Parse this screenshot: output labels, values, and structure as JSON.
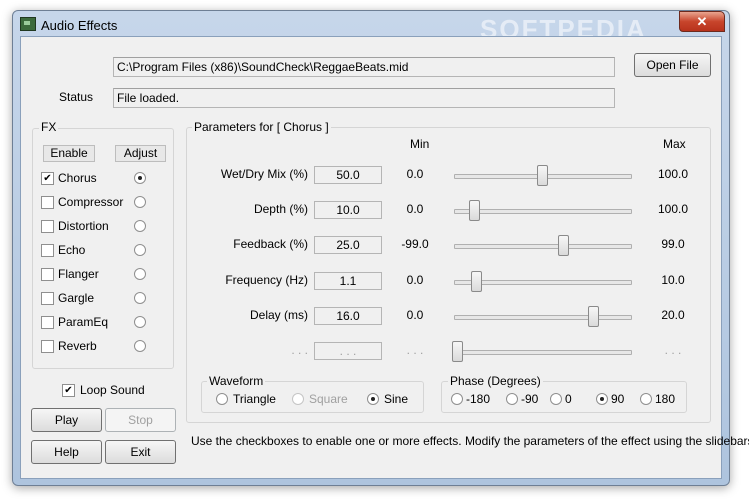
{
  "window": {
    "title": "Audio Effects",
    "close_label": "✕",
    "watermark": "SOFTPEDIA"
  },
  "file": {
    "path": "C:\\Program Files (x86)\\SoundCheck\\ReggaeBeats.mid",
    "open_button": "Open File",
    "status_label": "Status",
    "status_value": "File loaded."
  },
  "fx": {
    "group_label": "FX",
    "enable_header": "Enable",
    "adjust_header": "Adjust",
    "items": [
      {
        "label": "Chorus",
        "enabled": true,
        "selected": true
      },
      {
        "label": "Compressor",
        "enabled": false,
        "selected": false
      },
      {
        "label": "Distortion",
        "enabled": false,
        "selected": false
      },
      {
        "label": "Echo",
        "enabled": false,
        "selected": false
      },
      {
        "label": "Flanger",
        "enabled": false,
        "selected": false
      },
      {
        "label": "Gargle",
        "enabled": false,
        "selected": false
      },
      {
        "label": "ParamEq",
        "enabled": false,
        "selected": false
      },
      {
        "label": "Reverb",
        "enabled": false,
        "selected": false
      }
    ]
  },
  "loop_sound": {
    "label": "Loop Sound",
    "checked": true
  },
  "buttons": {
    "play": "Play",
    "stop": "Stop",
    "help": "Help",
    "exit": "Exit"
  },
  "params": {
    "group_label": "Parameters for [ Chorus ]",
    "min_header": "Min",
    "max_header": "Max",
    "rows": [
      {
        "label": "Wet/Dry Mix (%)",
        "value": "50.0",
        "min": "0.0",
        "max": "100.0",
        "level": 0.5
      },
      {
        "label": "Depth (%)",
        "value": "10.0",
        "min": "0.0",
        "max": "100.0",
        "level": 0.1
      },
      {
        "label": "Feedback (%)",
        "value": "25.0",
        "min": "-99.0",
        "max": "99.0",
        "level": 0.6263
      },
      {
        "label": "Frequency (Hz)",
        "value": "1.1",
        "min": "0.0",
        "max": "10.0",
        "level": 0.11
      },
      {
        "label": "Delay (ms)",
        "value": "16.0",
        "min": "0.0",
        "max": "20.0",
        "level": 0.8
      },
      {
        "label": ". . .",
        "value": ". . .",
        "min": ". . .",
        "max": ". . .",
        "level": 0.0,
        "disabled": true
      }
    ]
  },
  "waveform": {
    "group_label": "Waveform",
    "options": [
      {
        "label": "Triangle",
        "selected": false,
        "disabled": false
      },
      {
        "label": "Square",
        "selected": false,
        "disabled": true
      },
      {
        "label": "Sine",
        "selected": true,
        "disabled": false
      }
    ]
  },
  "phase": {
    "group_label": "Phase (Degrees)",
    "options": [
      {
        "label": "-180",
        "selected": false
      },
      {
        "label": "-90",
        "selected": false
      },
      {
        "label": "0",
        "selected": false
      },
      {
        "label": "90",
        "selected": true
      },
      {
        "label": "180",
        "selected": false
      }
    ]
  },
  "hint": "Use the checkboxes to enable one or more effects. Modify the parameters of the effect using the slidebars."
}
